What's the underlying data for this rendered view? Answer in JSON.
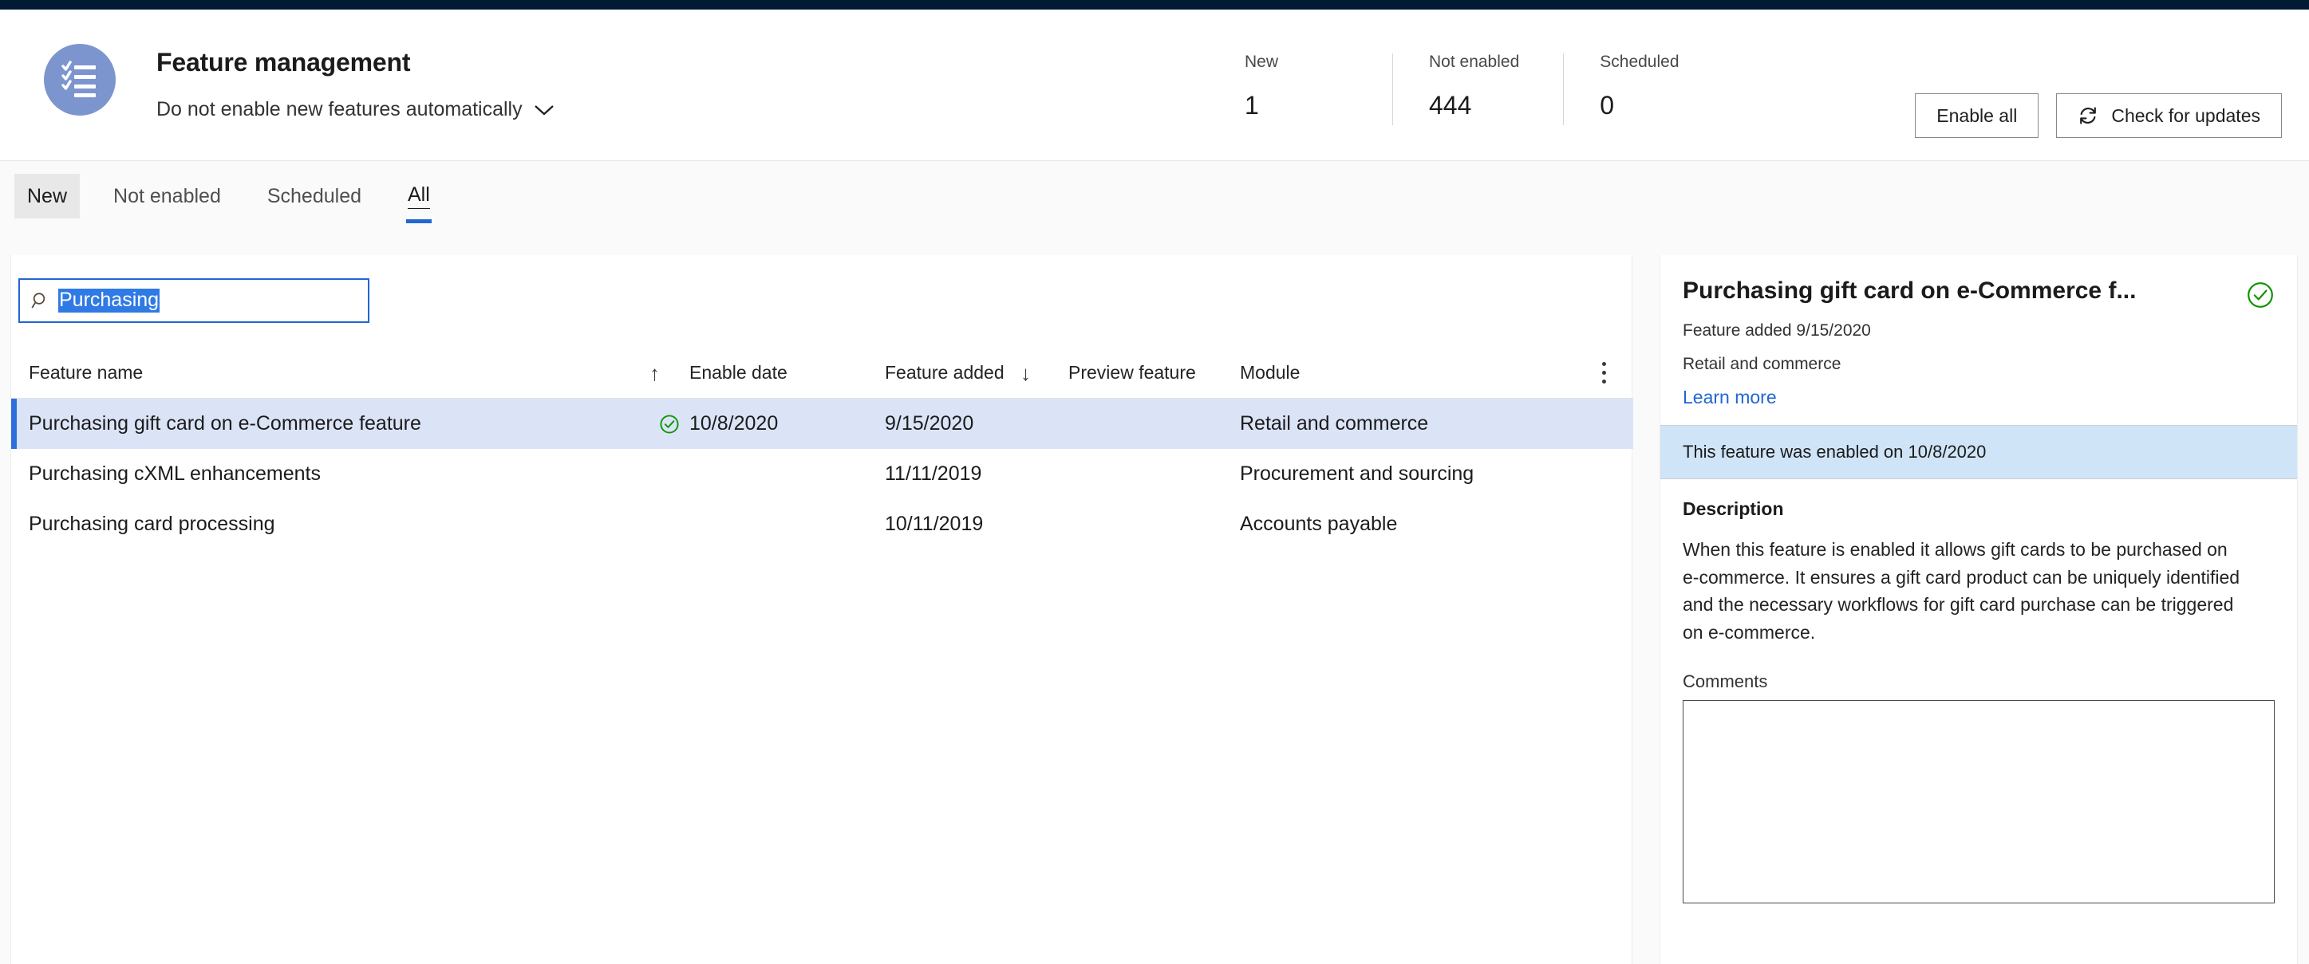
{
  "colors": {
    "topbar": "#001b33",
    "accent_blue": "#2266d3",
    "selection_blue": "#2f7ae5",
    "row_selected_bg": "#dbe4f7",
    "row_selected_accent": "#2e6fdb",
    "banner_bg": "#cfe4f7",
    "status_green": "#107c10",
    "header_icon_bg": "#7d95cf",
    "link_blue": "#2266d3"
  },
  "header": {
    "icon": "checklist-icon",
    "title": "Feature management",
    "subtitle": "Do not enable new features automatically",
    "subtitle_chevron": "chevron-down-icon",
    "stats": [
      {
        "label": "New",
        "value": "1"
      },
      {
        "label": "Not enabled",
        "value": "444"
      },
      {
        "label": "Scheduled",
        "value": "0"
      }
    ],
    "actions": {
      "enable_all": "Enable all",
      "check_updates": "Check for updates",
      "check_updates_icon": "refresh-icon"
    }
  },
  "tabs": [
    {
      "label": "New",
      "state": "hovered"
    },
    {
      "label": "Not enabled",
      "state": "default"
    },
    {
      "label": "Scheduled",
      "state": "default"
    },
    {
      "label": "All",
      "state": "active"
    }
  ],
  "search": {
    "icon": "search-icon",
    "value": "Purchasing",
    "placeholder": "Filter",
    "selected": true
  },
  "table": {
    "columns": [
      {
        "label": "Feature name",
        "sort": "ascending",
        "sort_icon": "arrow-up-icon"
      },
      {
        "label": "Enable date",
        "sort": "none"
      },
      {
        "label": "Feature added",
        "sort": "descending",
        "sort_icon": "arrow-down-icon"
      },
      {
        "label": "Preview feature",
        "sort": "none"
      },
      {
        "label": "Module",
        "sort": "none"
      }
    ],
    "header_menu_icon": "kebab-menu-icon",
    "rows": [
      {
        "feature_name": "Purchasing gift card on e-Commerce feature",
        "enabled_icon": "green-check-circle-icon",
        "enable_date": "10/8/2020",
        "feature_added": "9/15/2020",
        "preview_feature": "",
        "module": "Retail and commerce",
        "selected": true
      },
      {
        "feature_name": "Purchasing cXML enhancements",
        "enabled_icon": "",
        "enable_date": "",
        "feature_added": "11/11/2019",
        "preview_feature": "",
        "module": "Procurement and sourcing",
        "selected": false
      },
      {
        "feature_name": "Purchasing card processing",
        "enabled_icon": "",
        "enable_date": "",
        "feature_added": "10/11/2019",
        "preview_feature": "",
        "module": "Accounts payable",
        "selected": false
      }
    ]
  },
  "detail": {
    "title": "Purchasing gift card on e-Commerce f...",
    "status_icon": "green-check-circle-icon",
    "added_line": "Feature added 9/15/2020",
    "module_line": "Retail and commerce",
    "learn_more": "Learn more",
    "banner": "This feature was enabled on 10/8/2020",
    "description_heading": "Description",
    "description": "When this feature is enabled it allows gift cards to be purchased on e-commerce. It ensures a gift card product can be uniquely identified and the necessary workflows for gift card purchase can be triggered on e-commerce.",
    "comments_label": "Comments",
    "comments_value": "",
    "comments_placeholder": ""
  }
}
